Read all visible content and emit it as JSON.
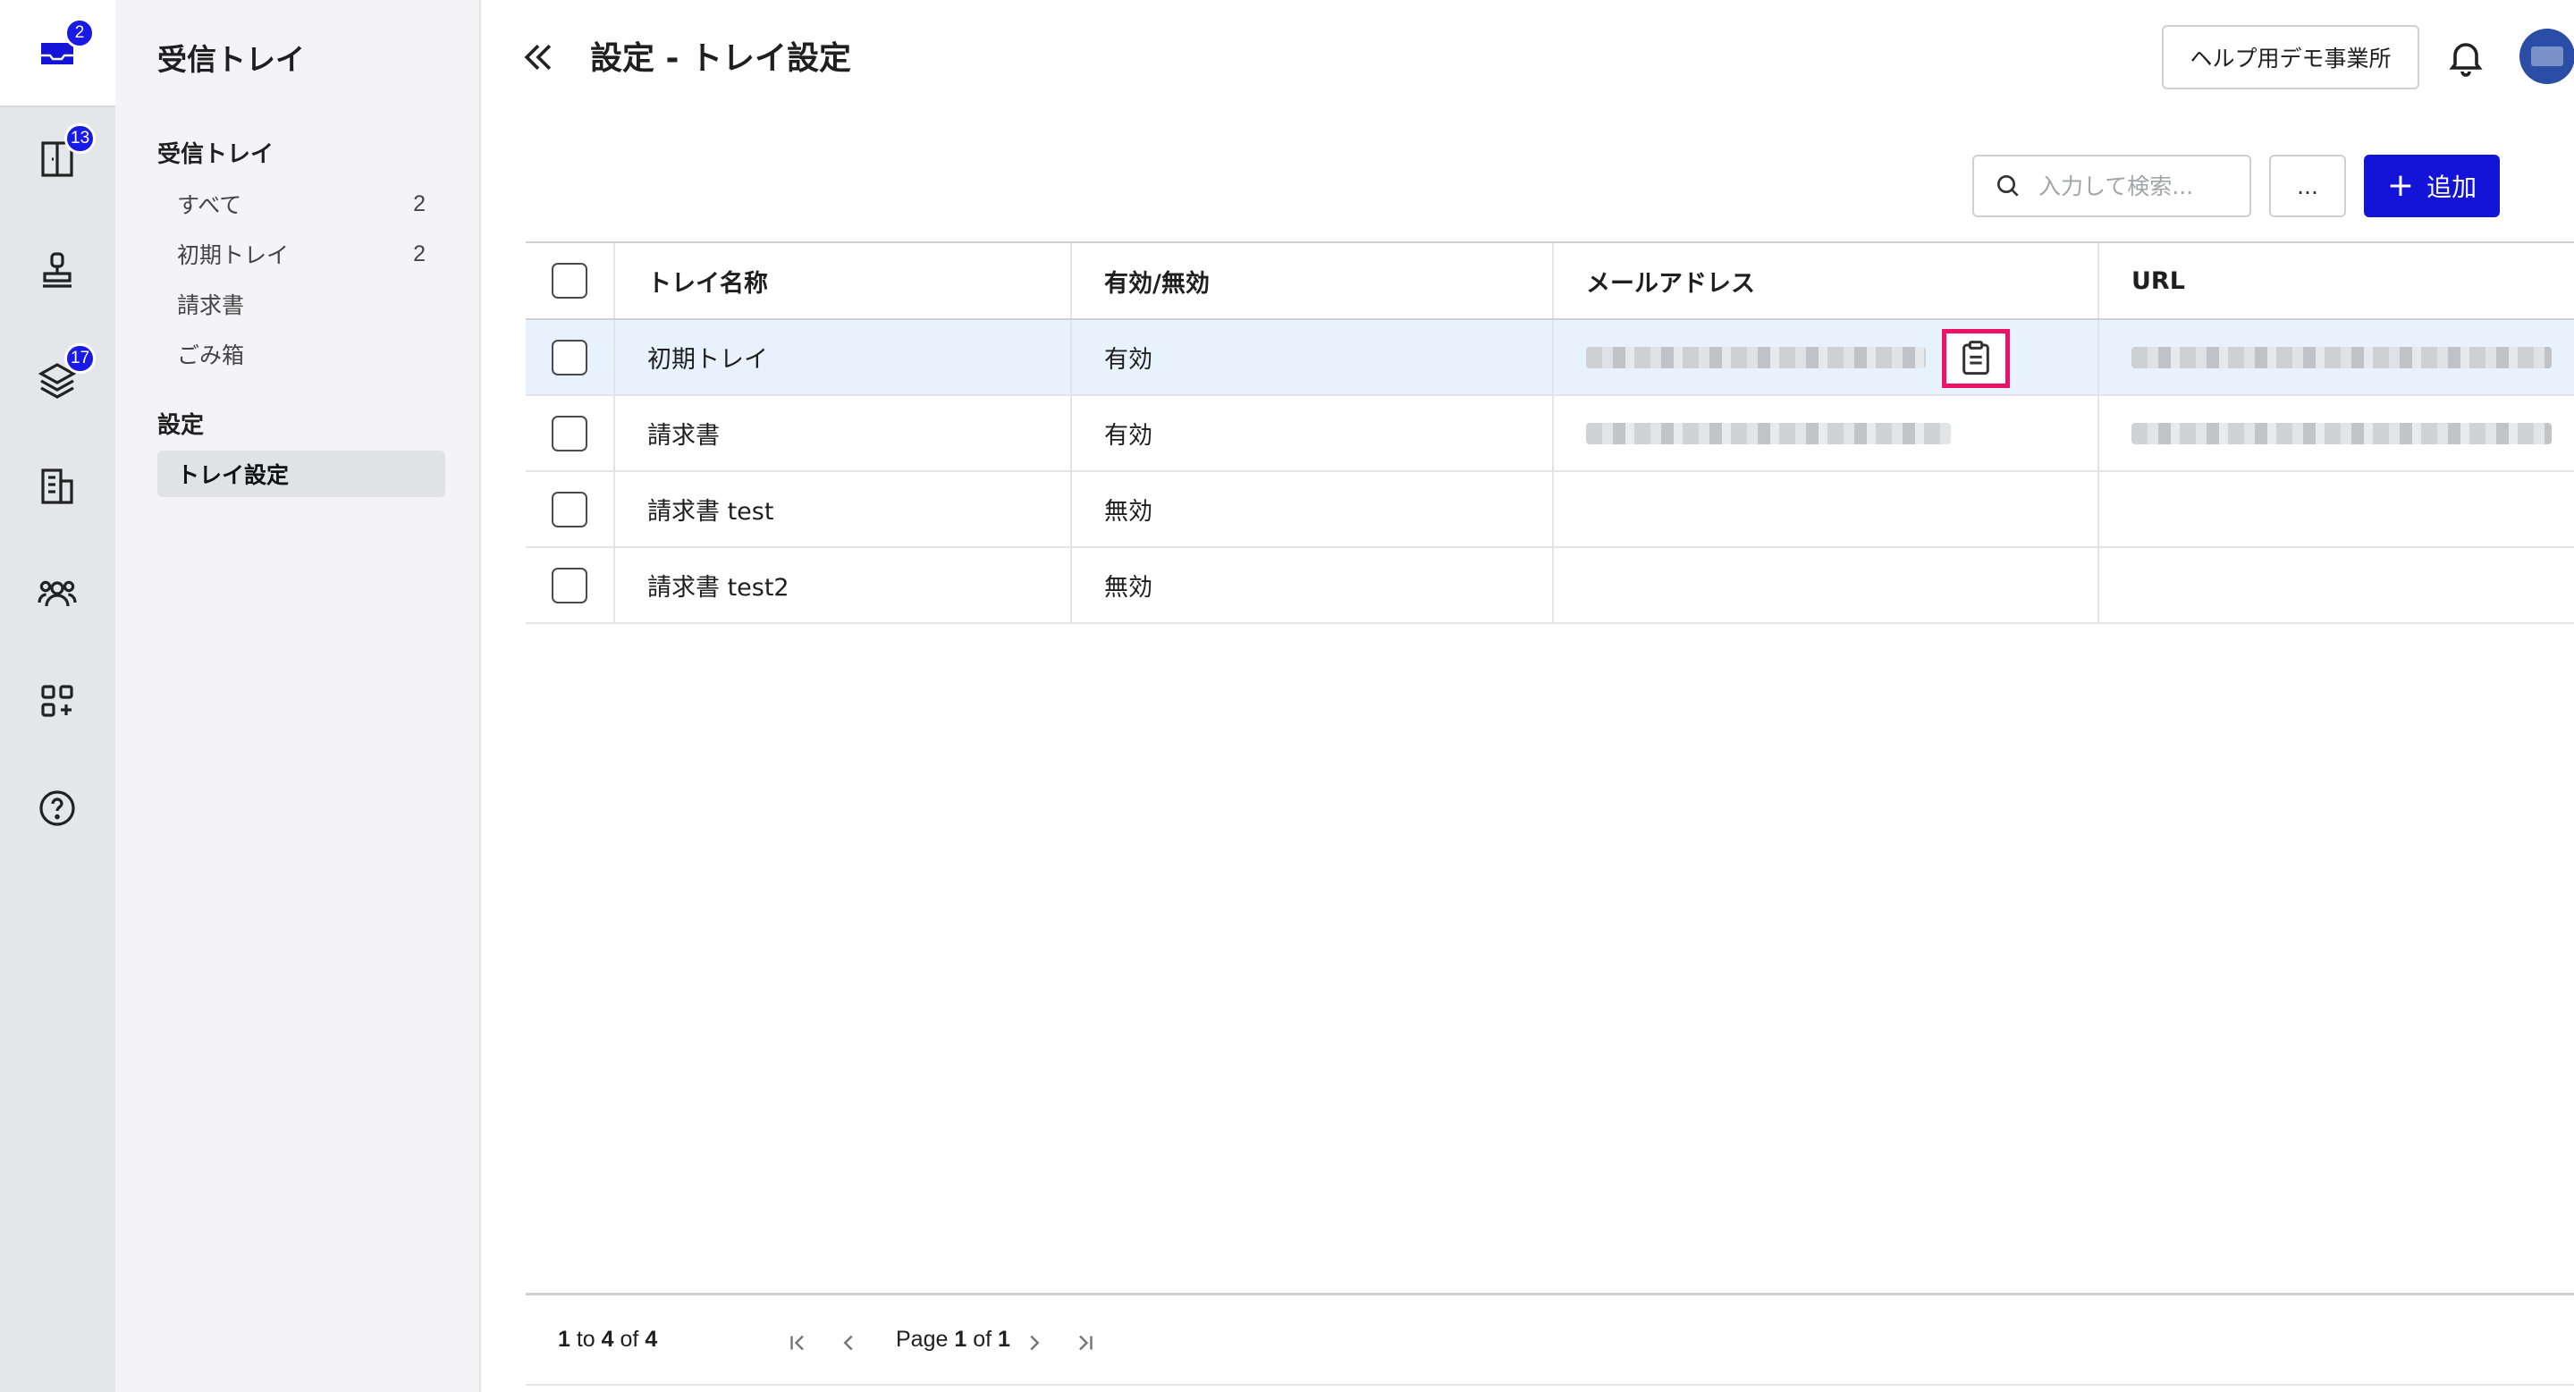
{
  "rail": {
    "inbox_badge": "2",
    "trays_badge": "13",
    "layers_badge": "17"
  },
  "sidebar": {
    "title": "受信トレイ",
    "inbox_section": "受信トレイ",
    "items": [
      {
        "label": "すべて",
        "count": "2"
      },
      {
        "label": "初期トレイ",
        "count": "2"
      },
      {
        "label": "請求書",
        "count": ""
      },
      {
        "label": "ごみ箱",
        "count": ""
      }
    ],
    "settings_section": "設定",
    "settings_items": [
      {
        "label": "トレイ設定"
      }
    ]
  },
  "header": {
    "title": "設定 - トレイ設定",
    "org_button": "ヘルプ用デモ事業所"
  },
  "toolbar": {
    "search_placeholder": "入力して検索...",
    "more_label": "...",
    "add_label": "追加"
  },
  "table": {
    "columns": [
      "トレイ名称",
      "有効/無効",
      "メールアドレス",
      "URL"
    ],
    "rows": [
      {
        "name": "初期トレイ",
        "status": "有効"
      },
      {
        "name": "請求書",
        "status": "有効"
      },
      {
        "name": "請求書 test",
        "status": "無効"
      },
      {
        "name": "請求書 test2",
        "status": "無効"
      }
    ]
  },
  "footer": {
    "from": "1",
    "to_word": "to",
    "to": "4",
    "of_word": "of",
    "total": "4",
    "page_word": "Page",
    "page": "1",
    "page_of": "of",
    "pages": "1"
  },
  "colors": {
    "accent": "#1414d8",
    "badge": "#1a1ae6",
    "highlight": "#ee1166",
    "selected_row": "#e7f2fd"
  }
}
